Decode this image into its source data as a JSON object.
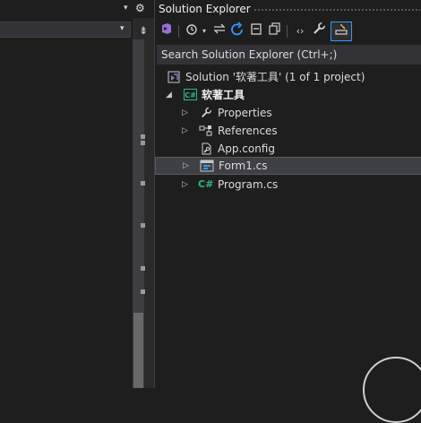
{
  "left_pane": {
    "topbar_chevron": "▾",
    "dropdown_chevron": "▾",
    "gear": "⚙",
    "split": "⇟"
  },
  "explorer": {
    "title": "Solution Explorer",
    "search_placeholder": "Search Solution Explorer (Ctrl+;)",
    "toolbar_icons": [
      "vs-switch-views-icon",
      "history-icon",
      "dropdown-icon",
      "sync-icon",
      "refresh-icon",
      "collapse-all-icon",
      "copy-icon",
      "code-view-icon",
      "wrench-icon",
      "preview-icon"
    ],
    "tree": {
      "solution": "Solution '软著工具' (1 of 1 project)",
      "project": "软著工具",
      "items": [
        {
          "label": "Properties",
          "icon": "wrench-icon",
          "expandable": true
        },
        {
          "label": "References",
          "icon": "references-icon",
          "expandable": true
        },
        {
          "label": "App.config",
          "icon": "config-file-icon",
          "expandable": false
        },
        {
          "label": "Form1.cs",
          "icon": "form-icon",
          "expandable": true,
          "selected": true
        },
        {
          "label": "Program.cs",
          "icon": "csharp-file-icon",
          "expandable": true
        }
      ]
    }
  },
  "colors": {
    "background": "#1e1e1e",
    "selection": "#3f3f46",
    "accent": "#3399ff",
    "csharp_green": "#2fb97b",
    "solution_purple": "#9b6fd3"
  }
}
